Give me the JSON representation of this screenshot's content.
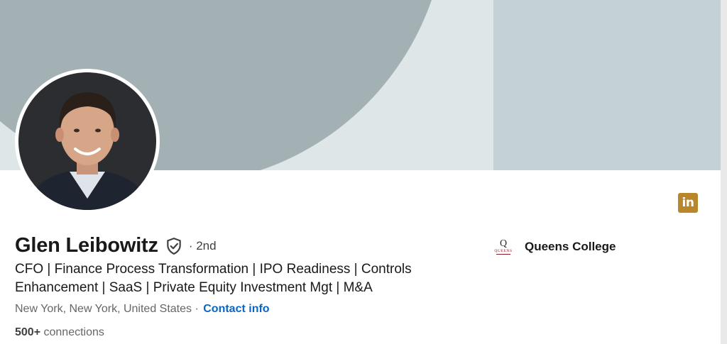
{
  "profile": {
    "name": "Glen Leibowitz",
    "degree": "· 2nd",
    "headline_line1": "CFO | Finance Process Transformation | IPO Readiness | Controls",
    "headline_line2": "Enhancement | SaaS | Private Equity Investment Mgt | M&A",
    "location": "New York, New York, United States ·",
    "contact_label": "Contact info",
    "connections_count": "500+",
    "connections_label": "connections"
  },
  "education": {
    "school_name": "Queens College",
    "logo_text": "QUEENS"
  },
  "icons": {
    "verified": "verified-shield-icon",
    "linkedin_badge": "linkedin-icon",
    "linkedin_badge_text": "in",
    "linkedin_badge_color": "#b8862b"
  },
  "colors": {
    "banner_dark": "#a3b1b4",
    "banner_light": "#dfe6e8",
    "banner_panel": "#c4d2d6",
    "link": "#0a66c2"
  }
}
